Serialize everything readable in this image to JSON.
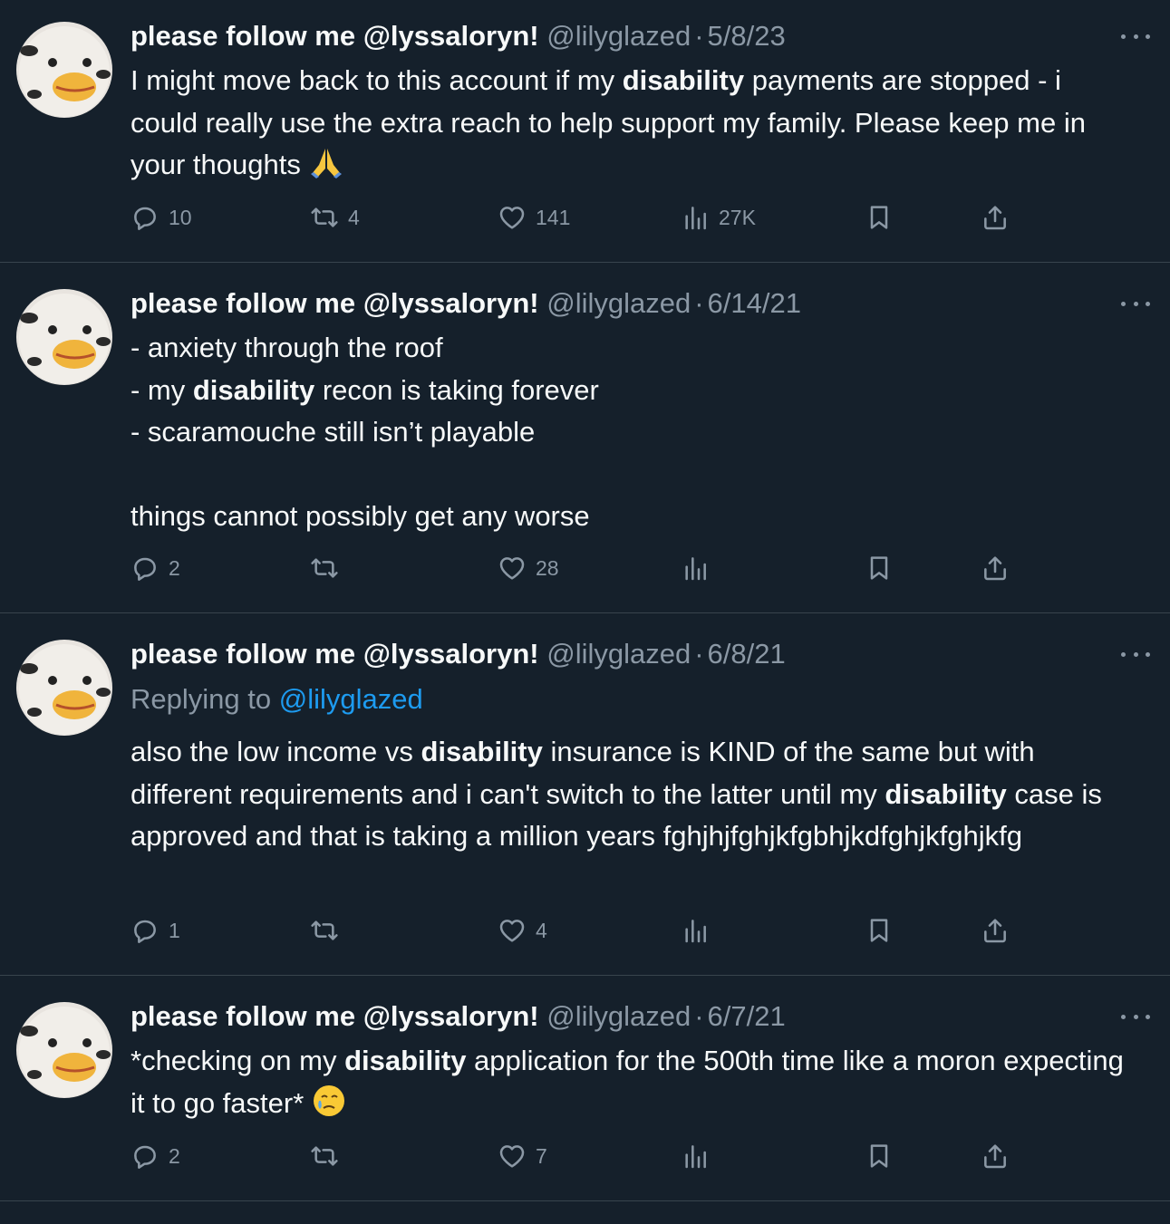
{
  "colors": {
    "background": "#15202b",
    "text": "#f7f9f9",
    "muted": "#8b98a5",
    "link": "#1d9bf0",
    "divider": "#38444d"
  },
  "icons": [
    "more-icon",
    "reply-icon",
    "retweet-icon",
    "like-icon",
    "views-icon",
    "bookmark-icon",
    "share-icon",
    "folded-hands-emoji",
    "crying-smile-emoji"
  ],
  "tweets": [
    {
      "name": "please follow me @lyssaloryn!",
      "handle": "@lilyglazed",
      "separator": "·",
      "date": "5/8/23",
      "segments": [
        {
          "t": "I might move back to this account if my "
        },
        {
          "t": "disability",
          "b": true
        },
        {
          "t": " payments are stopped - i could really use the extra reach to help support my family. Please keep me in your thoughts "
        }
      ],
      "stats": {
        "replies": "10",
        "retweets": "4",
        "likes": "141",
        "views": "27K"
      }
    },
    {
      "name": "please follow me @lyssaloryn!",
      "handle": "@lilyglazed",
      "separator": "·",
      "date": "6/14/21",
      "lines": [
        [
          {
            "t": "- anxiety through the roof"
          }
        ],
        [
          {
            "t": "- my "
          },
          {
            "t": "disability",
            "b": true
          },
          {
            "t": " recon is taking forever"
          }
        ],
        [
          {
            "t": "- scaramouche still isn’t playable"
          }
        ],
        [],
        [
          {
            "t": "things cannot possibly get any worse"
          }
        ]
      ],
      "stats": {
        "replies": "2",
        "retweets": "",
        "likes": "28",
        "views": ""
      }
    },
    {
      "name": "please follow me @lyssaloryn!",
      "handle": "@lilyglazed",
      "separator": "·",
      "date": "6/8/21",
      "replying_label": "Replying to",
      "replying_to": "@lilyglazed",
      "segments": [
        {
          "t": "also the low income vs "
        },
        {
          "t": "disability",
          "b": true
        },
        {
          "t": " insurance is KIND of the same but with different requirements and i can't switch to the latter until my "
        },
        {
          "t": "disability",
          "b": true
        },
        {
          "t": " case is approved and that is taking a million years fghjhjfghjkfgbhjkdfghjkfghjkfg"
        }
      ],
      "stats": {
        "replies": "1",
        "retweets": "",
        "likes": "4",
        "views": ""
      }
    },
    {
      "name": "please follow me @lyssaloryn!",
      "handle": "@lilyglazed",
      "separator": "·",
      "date": "6/7/21",
      "segments": [
        {
          "t": "*checking on my "
        },
        {
          "t": "disability",
          "b": true
        },
        {
          "t": " application for the 500th time like a moron expecting it to go faster* "
        }
      ],
      "stats": {
        "replies": "2",
        "retweets": "",
        "likes": "7",
        "views": ""
      }
    }
  ]
}
